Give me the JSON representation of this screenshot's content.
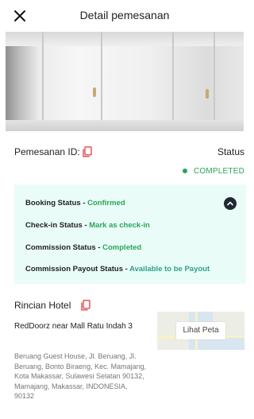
{
  "header": {
    "title": "Detail pemesanan",
    "close_icon": "close-icon"
  },
  "booking": {
    "id_label": "Pemesanan ID:",
    "copy_icon": "copy-icon",
    "status_label": "Status",
    "status_value": "COMPLETED"
  },
  "status_card": {
    "items": [
      {
        "label": "Booking Status",
        "separator": "-",
        "value": "Confirmed"
      },
      {
        "label": "Check-in Status",
        "separator": "-",
        "value": "Mark as check-in"
      },
      {
        "label": "Commission Status",
        "separator": "-",
        "value": "Completed"
      },
      {
        "label": "Commission Payout Status",
        "separator": "-",
        "value": "Available to be Payout"
      }
    ],
    "collapse_icon": "chevron-up-icon"
  },
  "hotel": {
    "section_title": "Rincian Hotel",
    "name": "RedDoorz near Mall Ratu Indah 3",
    "address": "Beruang Guest House, Jl. Beruang, Jl. Beruang, Bonto Biraeng, Kec. Mamajang, Kota Makassar, Sulawesi Selatan 90132, Mamajang, Makassar, INDONESIA, 90132",
    "map_button_label": "Lihat Peta"
  },
  "colors": {
    "accent_red": "#e5484d",
    "status_green": "#27a657",
    "card_background": "#eafcf8",
    "collapse_button": "#1f2933"
  }
}
